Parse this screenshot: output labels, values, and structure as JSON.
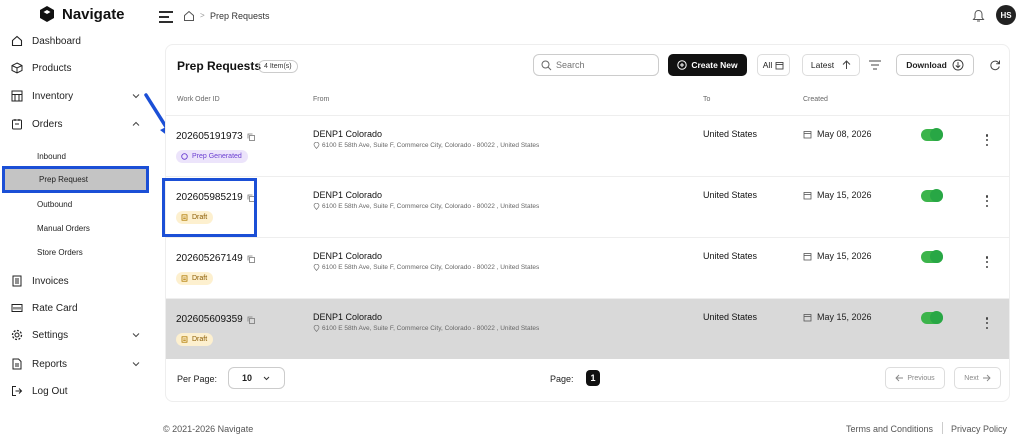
{
  "brand": {
    "name": "Navigate"
  },
  "sidebar": {
    "items": [
      {
        "label": "Dashboard",
        "icon": "home-icon"
      },
      {
        "label": "Products",
        "icon": "box-icon"
      },
      {
        "label": "Inventory",
        "icon": "warehouse-icon",
        "expandable": true
      },
      {
        "label": "Orders",
        "icon": "orders-icon",
        "expandable": true,
        "expanded": true
      },
      {
        "label": "Invoices",
        "icon": "invoice-icon"
      },
      {
        "label": "Rate Card",
        "icon": "rate-card-icon"
      },
      {
        "label": "Settings",
        "icon": "gear-icon",
        "expandable": true
      },
      {
        "label": "Reports",
        "icon": "report-icon",
        "expandable": true
      },
      {
        "label": "Log Out",
        "icon": "logout-icon"
      }
    ],
    "orders_sub": [
      {
        "label": "Inbound"
      },
      {
        "label": "Prep Request",
        "active": true
      },
      {
        "label": "Outbound"
      },
      {
        "label": "Manual Orders"
      },
      {
        "label": "Store Orders"
      }
    ]
  },
  "header": {
    "breadcrumb_current": "Prep Requests",
    "breadcrumb_sep": ">",
    "avatar_initials": "HS"
  },
  "main": {
    "title": "Prep Requests",
    "count": "4 Item(s)",
    "search_placeholder": "Search",
    "create_label": "Create New",
    "filter_all": "All",
    "sort_label": "Latest",
    "download_label": "Download",
    "columns": {
      "woid": "Work Oder ID",
      "from": "From",
      "to": "To",
      "created": "Created"
    },
    "rows": [
      {
        "woid": "202605191973",
        "status": "Prep Generated",
        "from_name": "DENP1 Colorado",
        "from_addr": "6100 E 58th Ave, Suite F, Commerce City, Colorado - 80022 , United States",
        "to": "United States",
        "created": "May 08, 2026",
        "enabled": true
      },
      {
        "woid": "202605985219",
        "status": "Draft",
        "from_name": "DENP1 Colorado",
        "from_addr": "6100 E 58th Ave, Suite F, Commerce City, Colorado - 80022 , United States",
        "to": "United States",
        "created": "May 15, 2026",
        "enabled": true
      },
      {
        "woid": "202605267149",
        "status": "Draft",
        "from_name": "DENP1 Colorado",
        "from_addr": "6100 E 58th Ave, Suite F, Commerce City, Colorado - 80022 , United States",
        "to": "United States",
        "created": "May 15, 2026",
        "enabled": true
      },
      {
        "woid": "202605609359",
        "status": "Draft",
        "from_name": "DENP1 Colorado",
        "from_addr": "6100 E 58th Ave, Suite F, Commerce City, Colorado - 80022 , United States",
        "to": "United States",
        "created": "May 15, 2026",
        "enabled": true
      }
    ],
    "per_page_label": "Per Page:",
    "per_page_value": "10",
    "page_label": "Page:",
    "page_value": "1",
    "prev_label": "Previous",
    "next_label": "Next"
  },
  "footer": {
    "copyright": "© 2021-2026 Navigate",
    "terms": "Terms and Conditions",
    "privacy": "Privacy Policy"
  },
  "colors": {
    "accent": "#111111",
    "highlight": "#1b4fd6",
    "toggle_on": "#28a745",
    "prep_badge": "#6b3fd1",
    "draft_badge": "#8a5a00"
  }
}
